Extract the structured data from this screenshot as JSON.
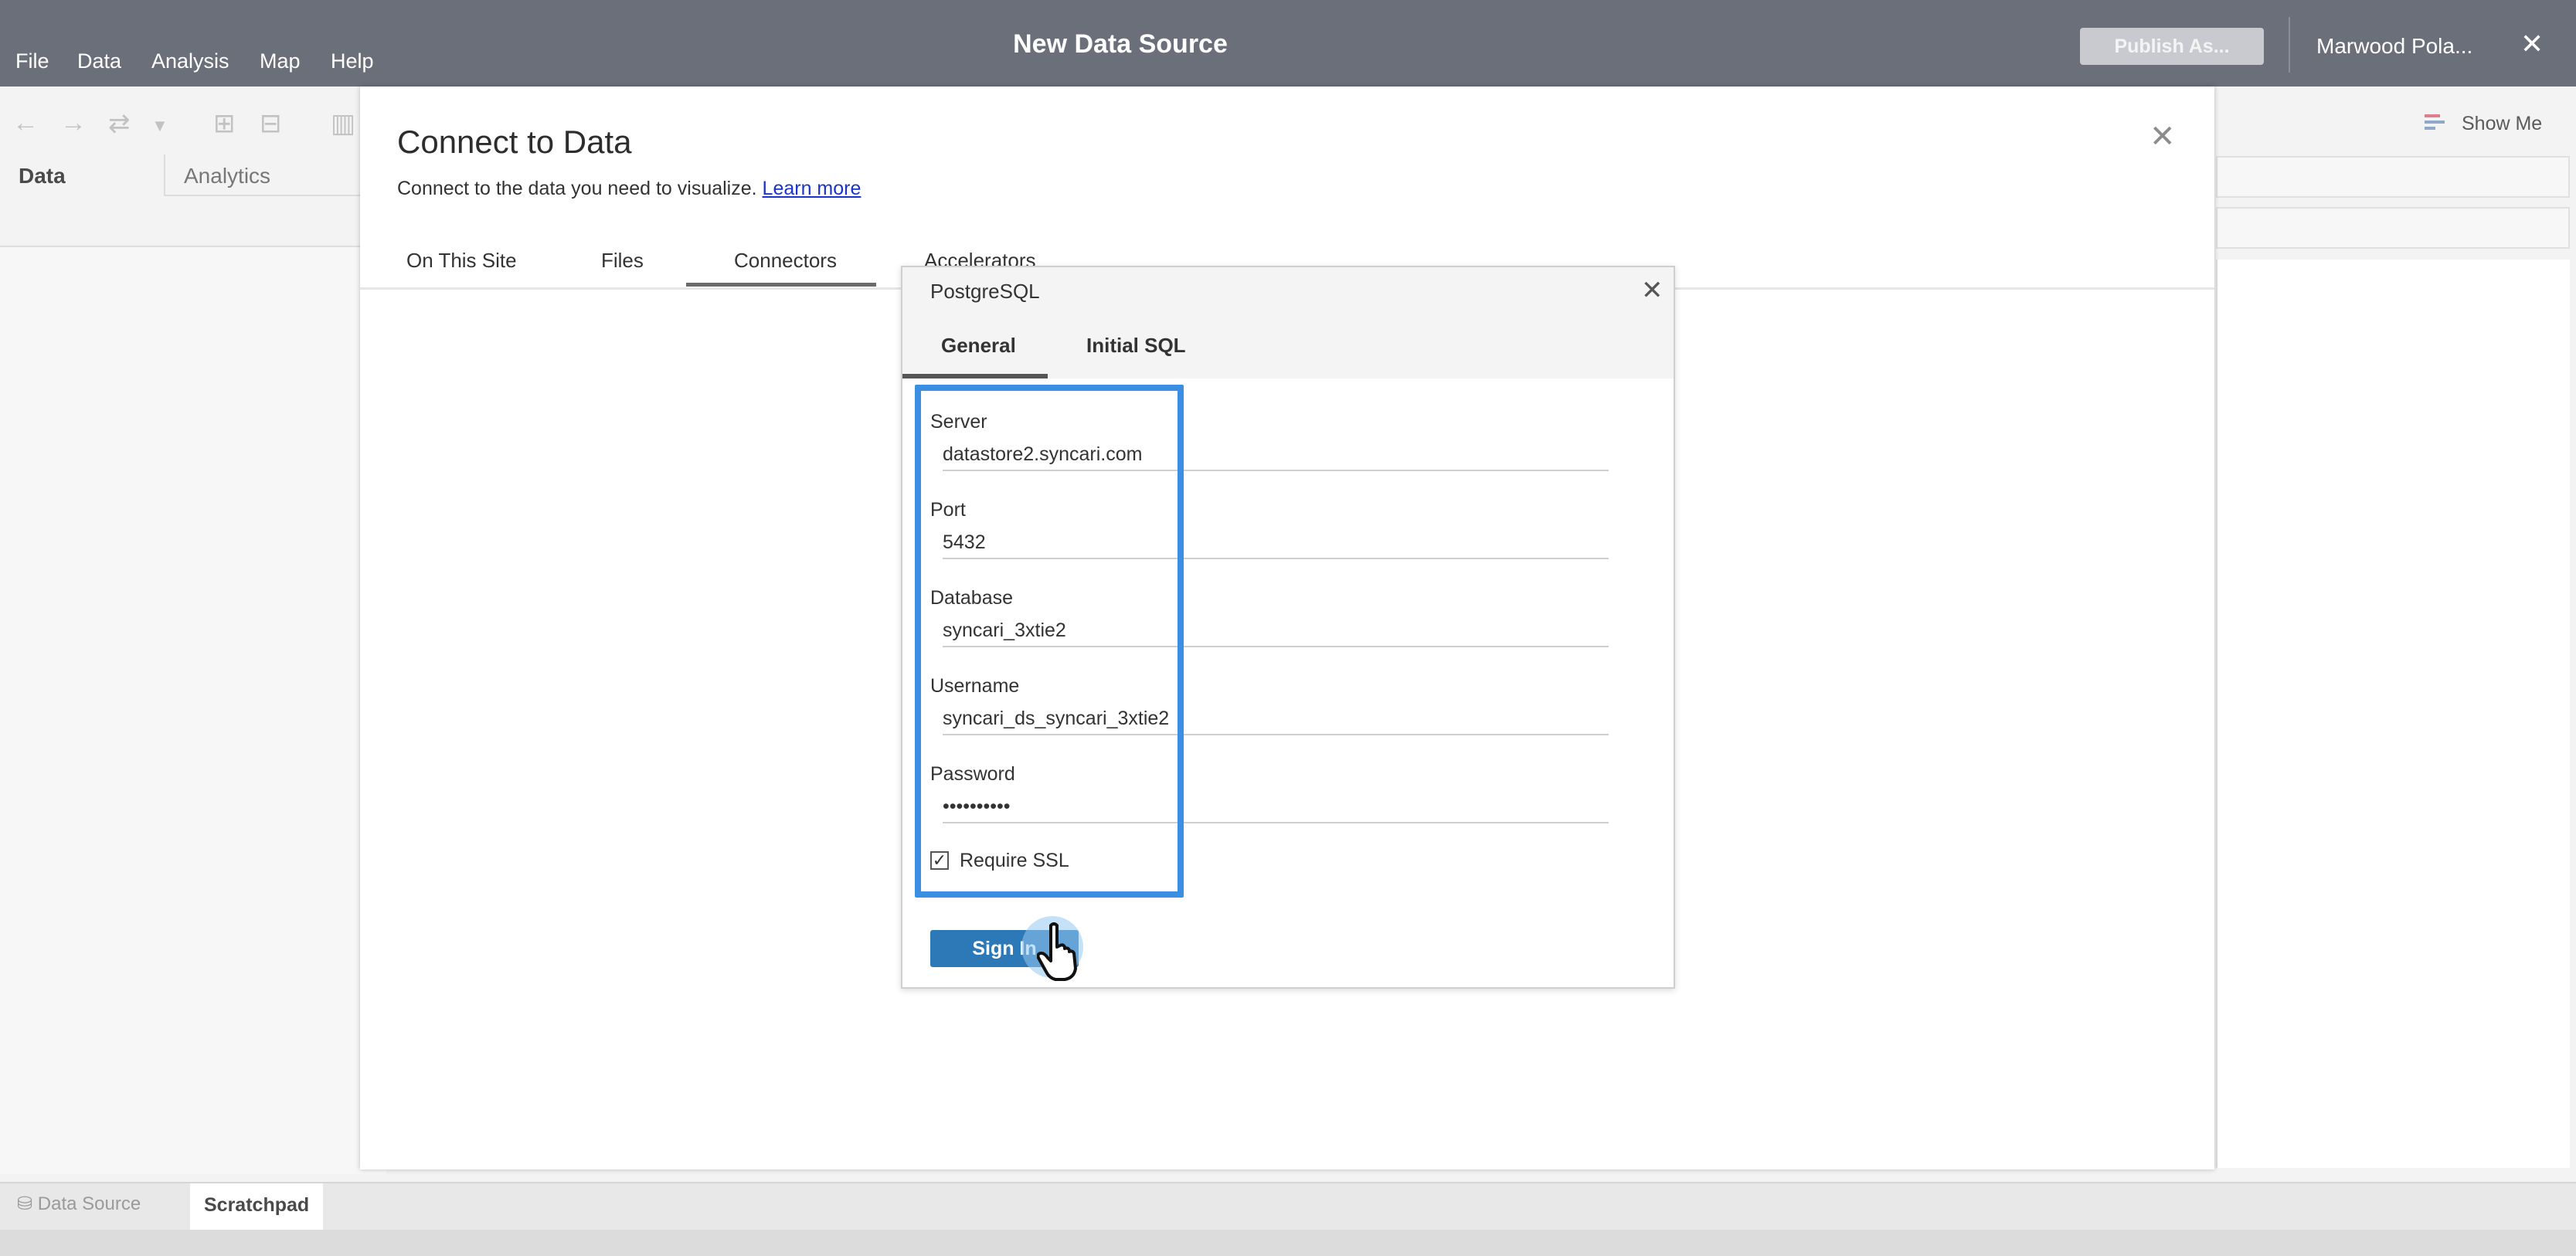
{
  "menu": [
    "File",
    "Data",
    "Analysis",
    "Map",
    "Help"
  ],
  "app_title": "New Data Source",
  "publish_label": "Publish As...",
  "user_name": "Marwood Pola...",
  "show_me_label": "Show Me",
  "side_panel": {
    "data_tab": "Data",
    "analytics_tab": "Analytics"
  },
  "bottom_tabs": {
    "data_source": "Data Source",
    "scratchpad": "Scratchpad"
  },
  "connect_dialog": {
    "title": "Connect to Data",
    "subtitle": "Connect to the data you need to visualize.",
    "learn_more": "Learn more",
    "tabs": [
      "On This Site",
      "Files",
      "Connectors",
      "Accelerators"
    ],
    "active_tab": "Connectors"
  },
  "pg_dialog": {
    "title": "PostgreSQL",
    "tabs": [
      "General",
      "Initial SQL"
    ],
    "active_tab": "General",
    "fields": {
      "server": {
        "label": "Server",
        "value": "datastore2.syncari.com"
      },
      "port": {
        "label": "Port",
        "value": "5432"
      },
      "database": {
        "label": "Database",
        "value": "syncari_3xtie2"
      },
      "username": {
        "label": "Username",
        "value": "syncari_ds_syncari_3xtie2"
      },
      "password": {
        "label": "Password",
        "value": "••••••••••"
      }
    },
    "require_ssl": {
      "label": "Require SSL",
      "checked": true,
      "mark": "✓"
    },
    "sign_in_label": "Sign In"
  },
  "colors": {
    "topbar": "#6b6f7a",
    "highlight": "#3b8fe2",
    "sign_in": "#2d79b8",
    "link": "#1a33cc"
  }
}
